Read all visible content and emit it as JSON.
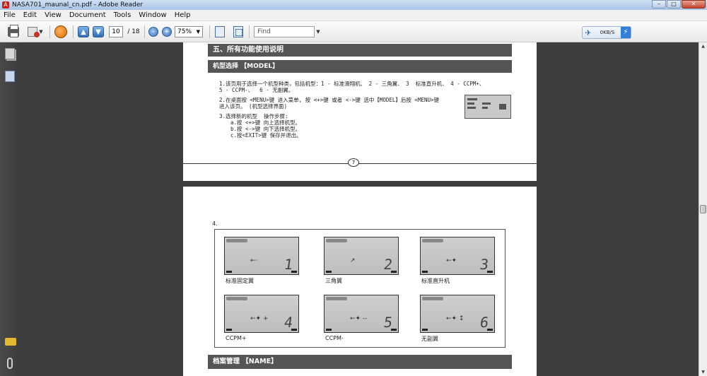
{
  "window": {
    "title": "NASA701_maunal_cn.pdf - Adobe Reader",
    "min_symbol": "–",
    "max_symbol": "□",
    "close_symbol": "✕"
  },
  "menu": [
    "File",
    "Edit",
    "View",
    "Document",
    "Tools",
    "Window",
    "Help"
  ],
  "toolbar": {
    "page_current": "10",
    "page_total": "/ 18",
    "zoom": "75%",
    "find_placeholder": "Find",
    "net_speed": "0KB/S",
    "icons": {
      "print": "print-icon",
      "email": "email-icon",
      "share": "share-icon",
      "prev": "arrow-up-icon",
      "next": "arrow-down-icon",
      "zoom_out": "zoom-out-icon",
      "zoom_in": "zoom-in-icon"
    }
  },
  "page1": {
    "section_title": "五、所有功能使用说明",
    "subsection_title": "机型选择 【MODEL】",
    "para1_line1": "1.该页用于选择一个机型种类，包括机型：1 - 标准滑翔机、 2 - 三角翼、 3  标准直升机、 4 - CCPM+、",
    "para1_line2": "5 - CCPM-、  6 - 无副翼。",
    "para2_line1": "2.在桌面按 <MENU>键 进入菜单, 按 <+>键 或者 <->键 选中【MODEL】后按 <MENU>键",
    "para2_line2": "进入该页。 (机型选择界面)",
    "para3_title": "3.选择新的机型  操作步骤:",
    "steps": [
      "a.按 <+>键 向上选择机型。",
      "b.按 <->键 向下选择机型。",
      "c.按<EXIT>键 保存并退出。"
    ],
    "page_number": "7"
  },
  "page2": {
    "item_label": "4.",
    "models": [
      {
        "digit": "1",
        "glyph": "←·",
        "label": "标准固定翼"
      },
      {
        "digit": "2",
        "glyph": "↗",
        "label": "三角翼"
      },
      {
        "digit": "3",
        "glyph": "←✦",
        "label": "标准直升机"
      },
      {
        "digit": "4",
        "glyph": "←✦ +",
        "label": "CCPM+"
      },
      {
        "digit": "5",
        "glyph": "←✦ --",
        "label": "CCPM-"
      },
      {
        "digit": "6",
        "glyph": "←✦ ↕",
        "label": "无副翼"
      }
    ],
    "bottom_section_title": "档案管理 【NAME】"
  }
}
